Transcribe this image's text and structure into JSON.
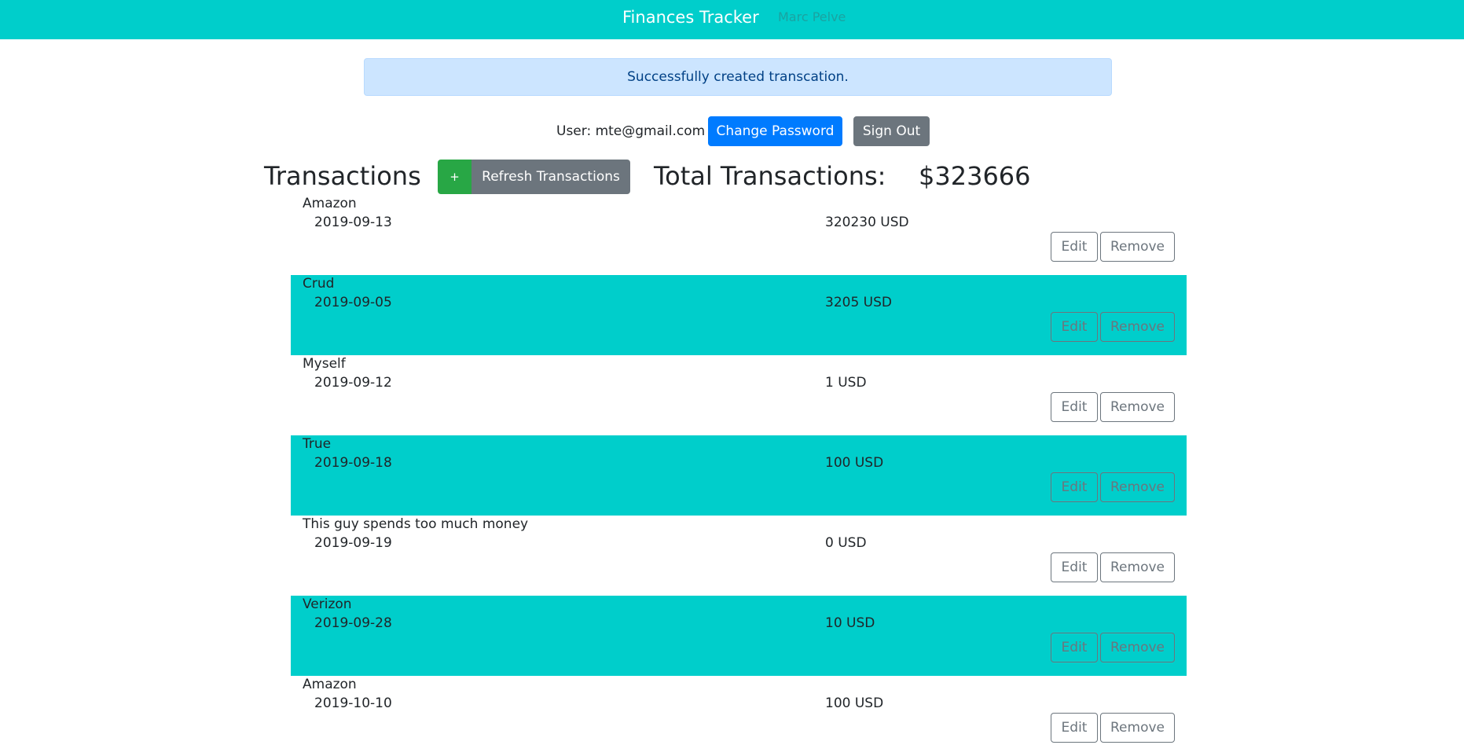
{
  "navbar": {
    "brand": "Finances Tracker",
    "user_name": "Marc Pelve"
  },
  "alert": {
    "message": "Successfully created transcation."
  },
  "user": {
    "label": "User: mte@gmail.com",
    "change_password_label": "Change Password",
    "sign_out_label": "Sign Out"
  },
  "transactions": {
    "heading": "Transactions",
    "add_label": "+",
    "refresh_label": "Refresh Transactions",
    "total_label": "Total Transactions:",
    "total_value": "$323666",
    "edit_label": "Edit",
    "remove_label": "Remove",
    "items": [
      {
        "name": "Amazon",
        "date": "2019-09-13",
        "amount": "320230 USD"
      },
      {
        "name": "Crud",
        "date": "2019-09-05",
        "amount": "3205 USD"
      },
      {
        "name": "Myself",
        "date": "2019-09-12",
        "amount": "1 USD"
      },
      {
        "name": "True",
        "date": "2019-09-18",
        "amount": "100 USD"
      },
      {
        "name": "This guy spends too much money",
        "date": "2019-09-19",
        "amount": "0 USD"
      },
      {
        "name": "Verizon",
        "date": "2019-09-28",
        "amount": "10 USD"
      },
      {
        "name": "Amazon",
        "date": "2019-10-10",
        "amount": "100 USD"
      }
    ]
  },
  "colors": {
    "navbar": "#00cecb",
    "alt_row": "#00cecb",
    "primary": "#007bff",
    "secondary": "#6c757d",
    "success": "#28a745",
    "alert_bg": "#cce5ff"
  }
}
